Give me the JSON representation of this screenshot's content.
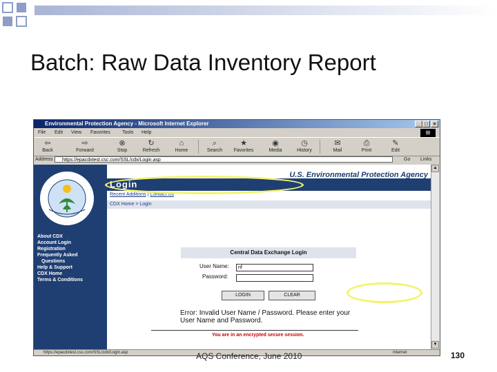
{
  "slide": {
    "title": "Batch: Raw Data Inventory Report",
    "footer": "AQS Conference, June 2010",
    "page_number": "130"
  },
  "browser": {
    "window_title": "Environmental Protection Agency - Microsoft Internet Explorer",
    "menu": [
      "File",
      "Edit",
      "View",
      "Favorites",
      "Tools",
      "Help"
    ],
    "toolbar": [
      {
        "label": "Back",
        "icon": "back-arrow-icon"
      },
      {
        "label": "Forward",
        "icon": "forward-arrow-icon"
      },
      {
        "label": "Stop",
        "icon": "stop-icon"
      },
      {
        "label": "Refresh",
        "icon": "refresh-icon"
      },
      {
        "label": "Home",
        "icon": "home-icon"
      },
      {
        "label": "Search",
        "icon": "search-icon"
      },
      {
        "label": "Favorites",
        "icon": "favorites-icon"
      },
      {
        "label": "Media",
        "icon": "media-icon"
      },
      {
        "label": "History",
        "icon": "history-icon"
      },
      {
        "label": "Mail",
        "icon": "mail-icon"
      },
      {
        "label": "Print",
        "icon": "print-icon"
      },
      {
        "label": "Edit",
        "icon": "edit-icon"
      }
    ],
    "address_label": "Address",
    "address_url": "https://epacdxtest.csc.com/SSL/cdx/Login.asp",
    "go_label": "Go",
    "links_label": "Links",
    "status_text": "https://epacdxtest.csc.com/SSL/cdx/Login.asp",
    "status_zone": "Internet"
  },
  "page": {
    "agency_name": "U.S. Environmental Protection Agency",
    "section_title": "Login",
    "links": [
      "Recent Additions",
      "Contact Us"
    ],
    "breadcrumb": "CDX Home > Login",
    "nav": [
      "About CDX",
      "Account Login",
      "Registration",
      "Frequently Asked",
      "Questions",
      "Help & Support",
      "CDX Home",
      "Terms & Conditions"
    ],
    "login_heading": "Central Data Exchange Login",
    "username_label": "User Name:",
    "username_value": "nf",
    "password_label": "Password:",
    "login_button": "LOGIN",
    "clear_button": "CLEAR",
    "error_message": "Error: Invalid User Name / Password. Please enter your User Name and Password.",
    "secure_note": "You are in an encrypted secure session."
  },
  "colors": {
    "epa_navy": "#1f3f73",
    "highlight_yellow": "#f3f36a",
    "secure_red": "#cc0000"
  }
}
